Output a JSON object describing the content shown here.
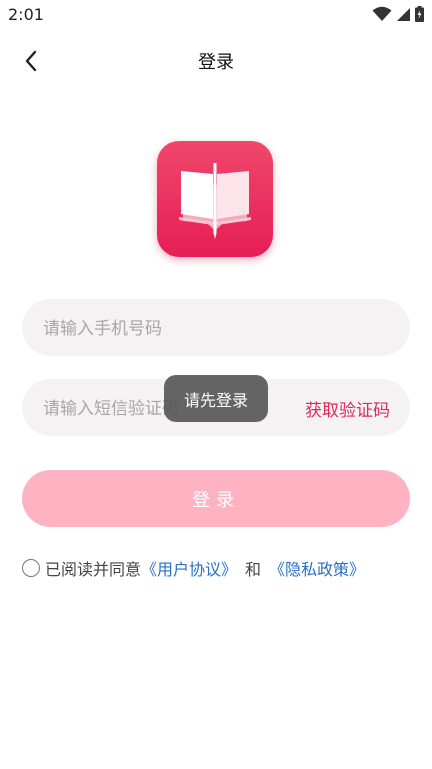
{
  "status_bar": {
    "time": "2:01"
  },
  "nav": {
    "title": "登录"
  },
  "form": {
    "phone_placeholder": "请输入手机号码",
    "code_placeholder": "请输入短信验证码",
    "get_code_label": "获取验证码",
    "login_label": "登录"
  },
  "toast": {
    "text": "请先登录"
  },
  "agreement": {
    "prefix": "已阅读并同意",
    "user_agreement": "《用户协议》",
    "conjunction": "和",
    "privacy_policy": "《隐私政策》"
  },
  "colors": {
    "brand": "#e51e57",
    "login_button": "#ffb3c2",
    "link": "#2a6fc8",
    "input_bg": "#f4f2f3"
  },
  "icons": [
    "wifi-icon",
    "cell-signal-icon",
    "battery-icon",
    "back-arrow-icon",
    "app-logo-book-icon"
  ]
}
